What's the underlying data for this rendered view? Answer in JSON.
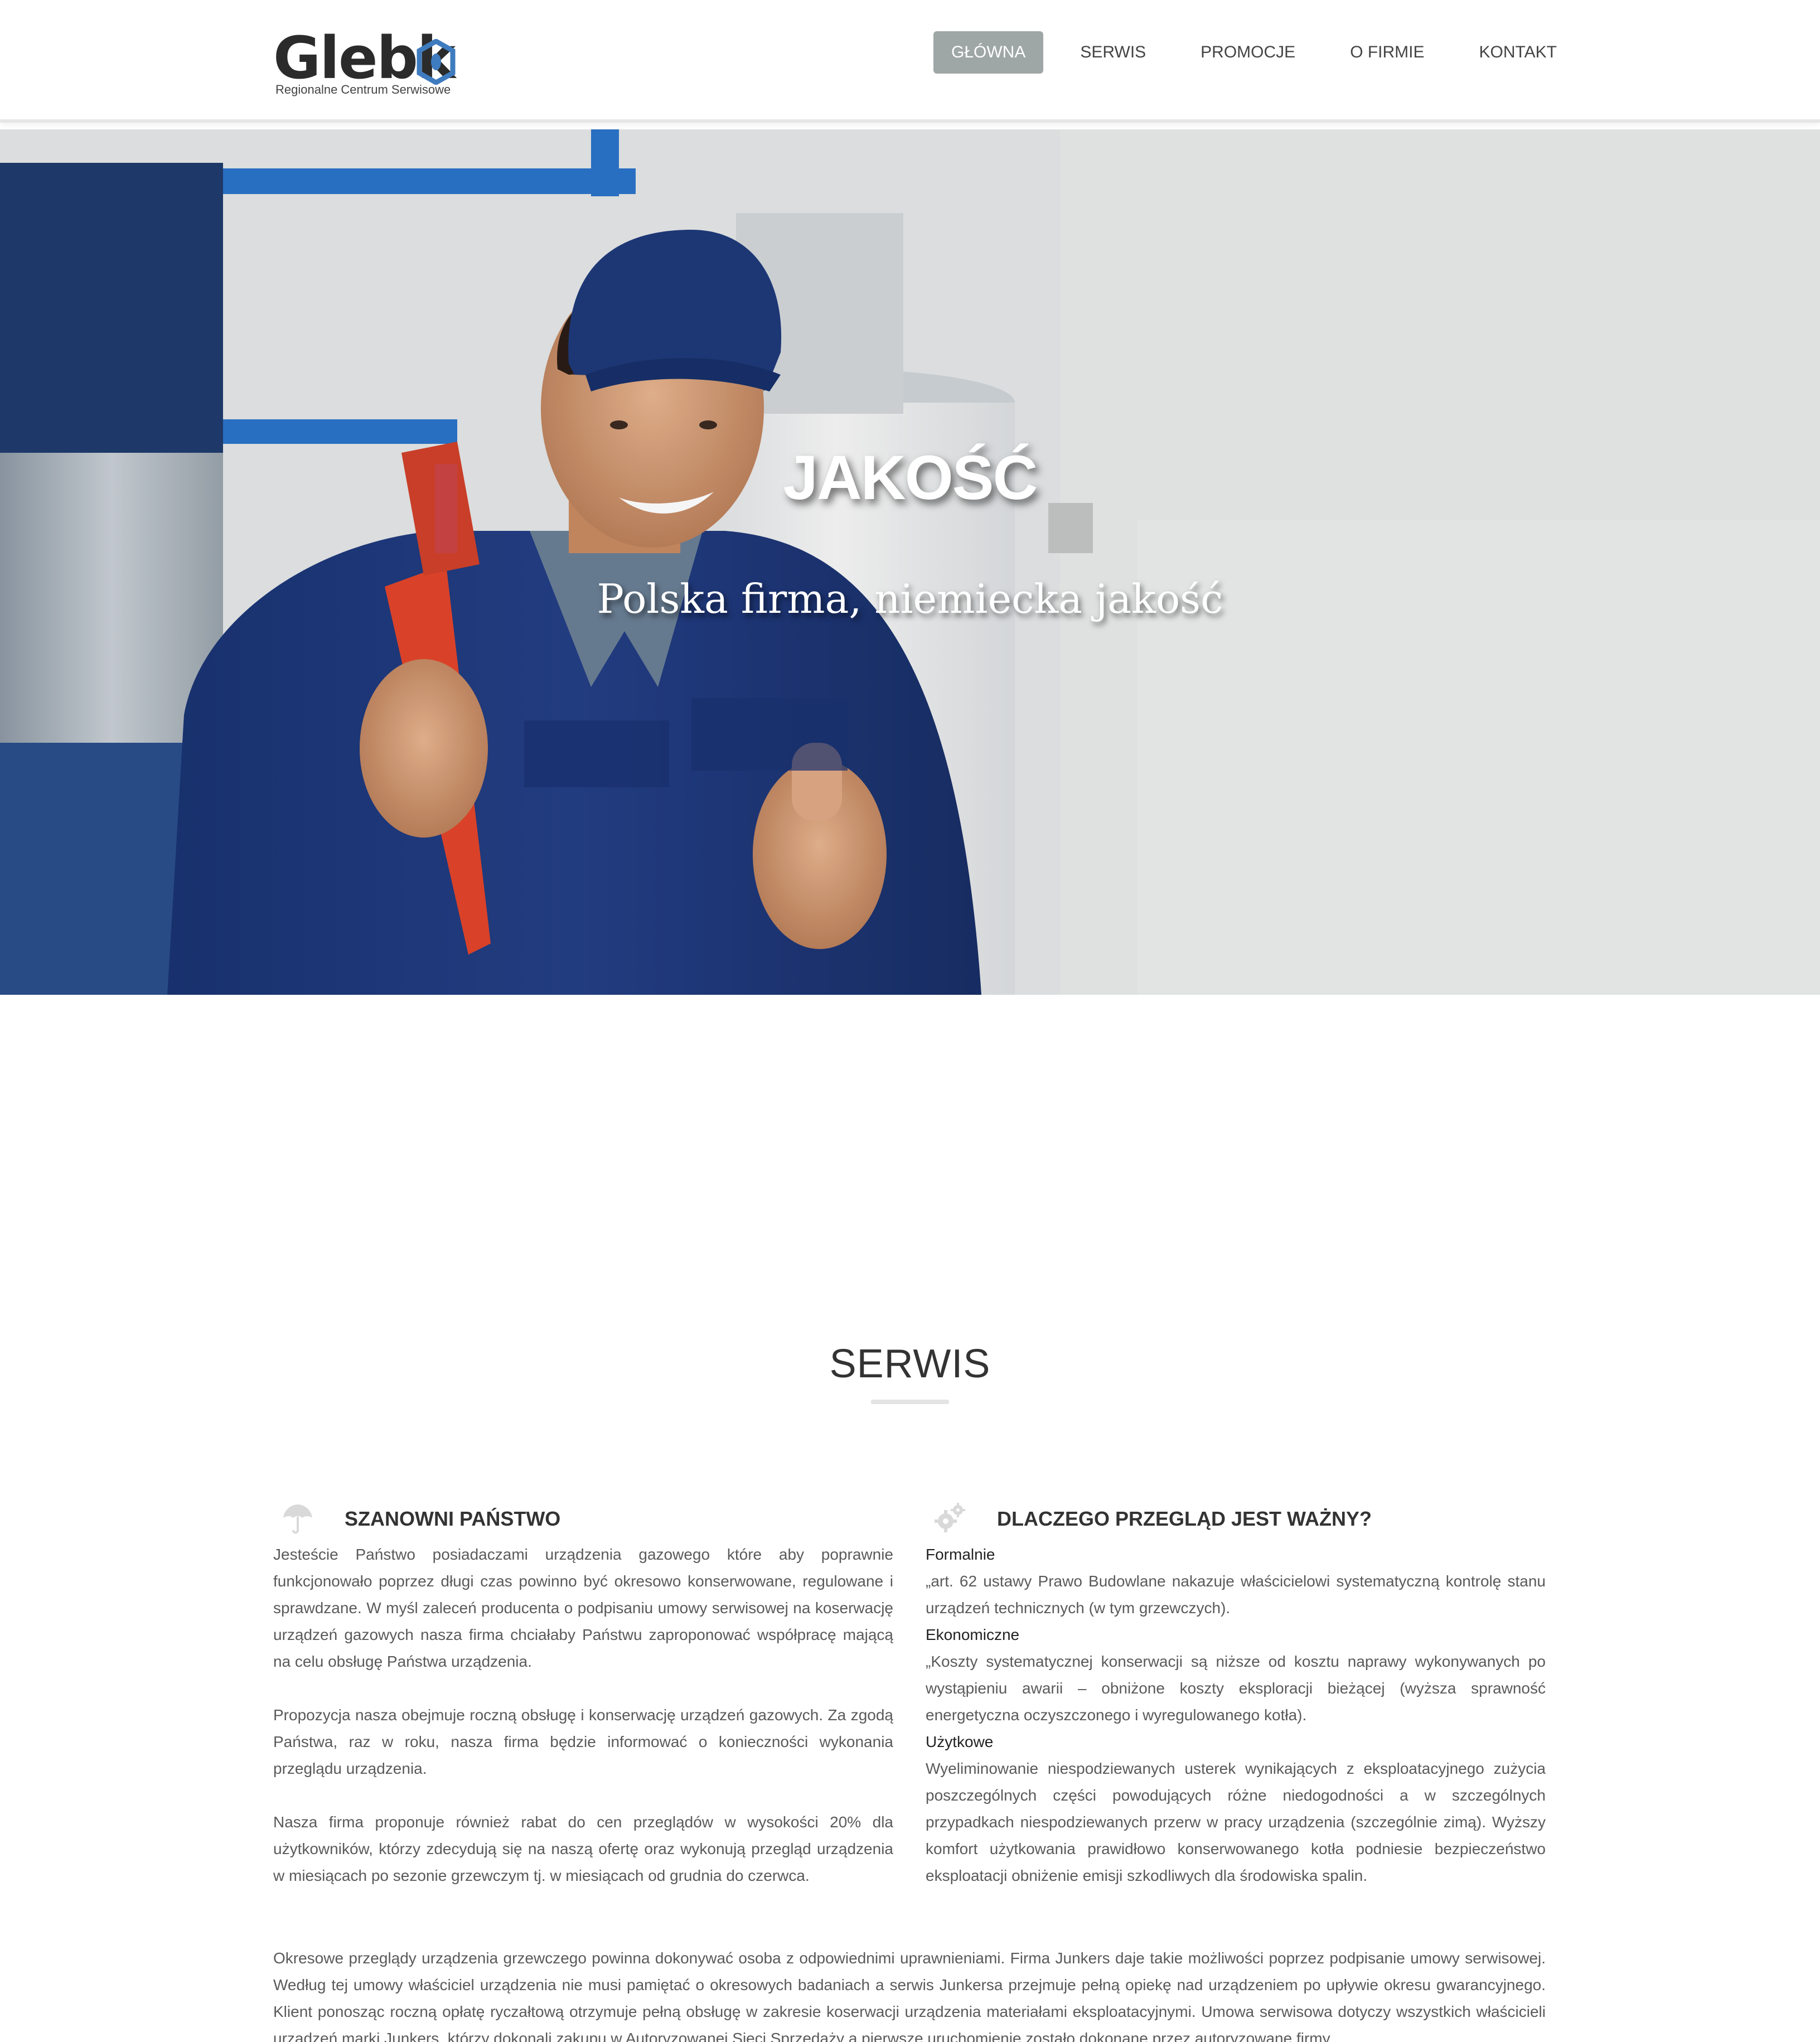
{
  "header": {
    "logo_text": "Glebko",
    "logo_tagline": "Regionalne Centrum Serwisowe",
    "nav": [
      {
        "label": "GŁÓWNA",
        "active": true
      },
      {
        "label": "SERWIS",
        "active": false
      },
      {
        "label": "PROMOCJE",
        "active": false
      },
      {
        "label": "O FIRMIE",
        "active": false
      },
      {
        "label": "KONTAKT",
        "active": false
      }
    ]
  },
  "hero": {
    "title": "JAKOŚĆ",
    "subtitle": "Polska firma, niemiecka jakość"
  },
  "section": {
    "title": "SERWIS",
    "left": {
      "icon": "umbrella-icon",
      "heading": "SZANOWNI PAŃSTWO",
      "paragraphs": [
        "Jesteście Państwo posiadaczami urządzenia gazowego które aby poprawnie funkcjonowało poprzez długi czas powinno być okresowo konserwowane, regulowane i sprawdzane. W myśl zaleceń producenta o podpisaniu umowy serwisowej na koserwację urządzeń gazowych nasza firma chciałaby Państwu zaproponować współpracę mającą na celu obsługę Państwa urządzenia.",
        "Propozycja nasza obejmuje roczną obsługę i konserwację urządzeń gazowych. Za zgodą Państwa, raz w roku, nasza firma będzie informować o konieczności wykonania przeglądu urządzenia.",
        "Nasza firma proponuje również rabat do cen przeglądów w wysokości 20% dla użytkowników, którzy zdecydują się na naszą ofertę oraz wykonują przegląd urządzenia w miesiącach po sezonie grzewczym tj. w miesiącach od grudnia do czerwca."
      ]
    },
    "right": {
      "icon": "gears-icon",
      "heading": "DLACZEGO PRZEGLĄD JEST WAŻNY?",
      "items": [
        {
          "label": "Formalnie",
          "text": "„art. 62 ustawy Prawo Budowlane nakazuje właścicielowi systematyczną kontrolę stanu urządzeń technicznych (w tym grzewczych)."
        },
        {
          "label": "Ekonomiczne",
          "text": "„Koszty systematycznej konserwacji są niższe od kosztu naprawy wykonywanych po wystąpieniu awarii – obniżone koszty eksploracji bieżącej (wyższa sprawność energetyczna oczyszczonego i wyregulowanego kotła)."
        },
        {
          "label": "Użytkowe",
          "text": "Wyeliminowanie niespodziewanych usterek wynikających z eksploatacyjnego zużycia poszczególnych części powodujących różne niedogodności a w szczególnych przypadkach niespodziewanych przerw w pracy urządzenia (szczególnie zimą). Wyższy komfort użytkowania prawidłowo konserwowanego kotła podniesie bezpieczeństwo eksploatacji obniżenie emisji szkodliwych dla środowiska spalin."
        }
      ]
    },
    "bottom_paragraph": "Okresowe przeglądy urządzenia grzewczego powinna dokonywać osoba z odpowiednimi uprawnieniami. Firma Junkers daje takie możliwości poprzez podpisanie umowy serwisowej. Według tej umowy właściciel urządzenia nie musi pamiętać o okresowych badaniach a serwis Junkersa przejmuje pełną opiekę nad urządzeniem po upływie okresu gwarancyjnego. Klient ponosząc roczną opłatę ryczałtową otrzymuje pełną obsługę w zakresie koserwacji urządzenia materiałami eksploatacyjnymi. Umowa serwisowa dotyczy wszystkich właścicieli urządzeń marki Junkers, którzy dokonali zakupu w Autoryzowanej Sieci Sprzedaży a pierwsze uruchomienie zostało dokonane przez autoryzowane firmy"
  }
}
